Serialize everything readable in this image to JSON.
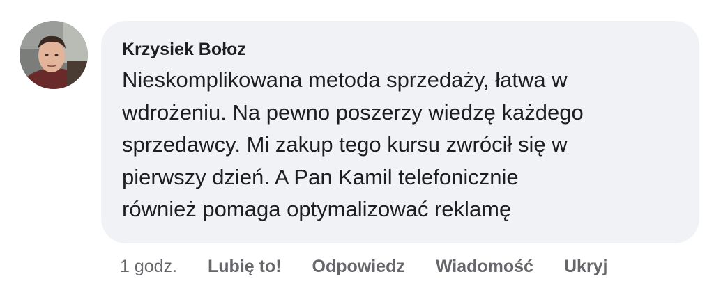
{
  "comment": {
    "author": "Krzysiek Bołoz",
    "text_lines": [
      "Nieskomplikowana metoda sprzedaży, łatwa w",
      "wdrożeniu. Na pewno poszerzy wiedzę każdego",
      "sprzedawcy. Mi zakup tego kursu zwrócił się w",
      "pierwszy dzień. A Pan Kamil telefonicznie",
      "również pomaga optymalizować reklamę"
    ],
    "timestamp": "1 godz.",
    "actions": {
      "like": "Lubię to!",
      "reply": "Odpowiedz",
      "message": "Wiadomość",
      "hide": "Ukryj"
    }
  },
  "colors": {
    "bubble_background": "#f0f2f5",
    "primary_text": "#1c1e21",
    "secondary_text": "#65676b"
  }
}
